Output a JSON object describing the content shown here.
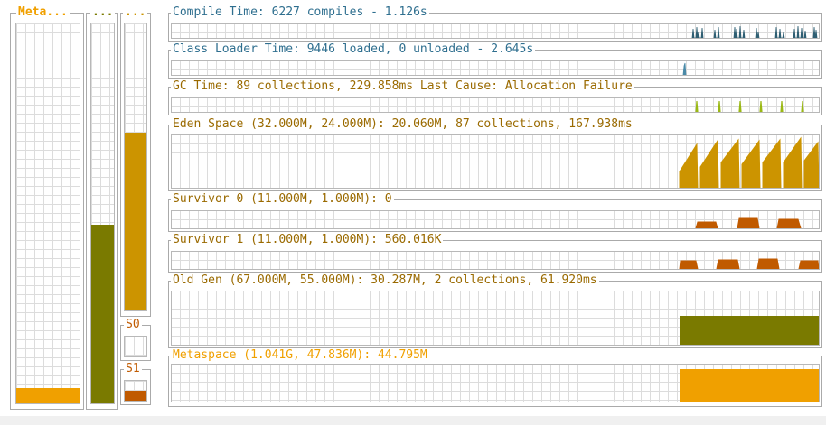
{
  "colors": {
    "compile": "#2f5f73",
    "classloader": "#4a8aa8",
    "gc": "#9ab814",
    "eden": "#cc9400",
    "survivor": "#c05a00",
    "old": "#7a7a00",
    "meta": "#f0a000",
    "title_blue": "#2f6f8f",
    "title_brown": "#9a6a00"
  },
  "left_bars": {
    "meta": {
      "label": "Meta...",
      "fill": 0.04
    },
    "old": {
      "label": "...",
      "fill": 0.47
    },
    "eden": {
      "label": "...",
      "fill": 0.62
    },
    "s0": {
      "label": "S0",
      "fill": 0.0
    },
    "s1": {
      "label": "S1",
      "fill": 0.5
    }
  },
  "panels": {
    "compile": {
      "title": "Compile Time: 6227 compiles - 1.126s"
    },
    "classloader": {
      "title": "Class Loader Time: 9446 loaded, 0 unloaded - 2.645s"
    },
    "gc": {
      "title": "GC Time: 89 collections, 229.858ms Last Cause: Allocation Failure"
    },
    "eden": {
      "title": "Eden Space (32.000M, 24.000M): 20.060M, 87 collections, 167.938ms"
    },
    "s0": {
      "title": "Survivor 0 (11.000M, 1.000M): 0"
    },
    "s1": {
      "title": "Survivor 1 (11.000M, 1.000M): 560.016K"
    },
    "old": {
      "title": "Old Gen (67.000M, 55.000M): 30.287M, 2 collections, 61.920ms"
    },
    "meta": {
      "title": "Metaspace (1.041G, 47.836M): 44.795M"
    }
  }
}
